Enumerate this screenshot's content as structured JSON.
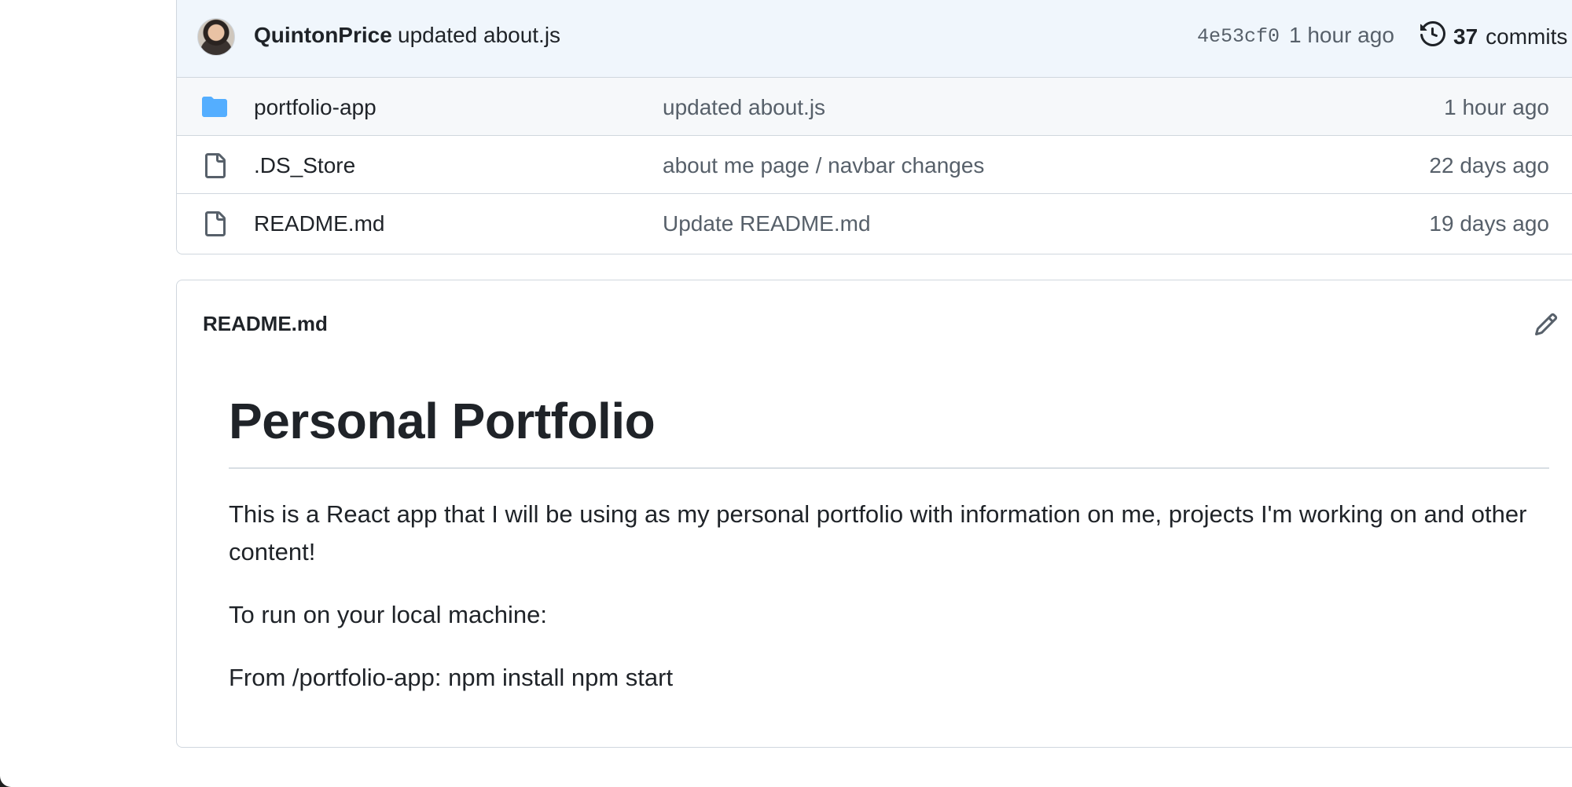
{
  "latest_commit": {
    "author": "QuintonPrice",
    "message": "updated about.js",
    "hash": "4e53cf0",
    "time": "1 hour ago",
    "commit_count": "37",
    "commits_label": "commits"
  },
  "files": [
    {
      "type": "folder",
      "icon": "folder-icon",
      "name": "portfolio-app",
      "last_commit": "updated about.js",
      "age": "1 hour ago"
    },
    {
      "type": "file",
      "icon": "file-icon",
      "name": ".DS_Store",
      "last_commit": "about me page / navbar changes",
      "age": "22 days ago"
    },
    {
      "type": "file",
      "icon": "file-icon",
      "name": "README.md",
      "last_commit": "Update README.md",
      "age": "19 days ago"
    }
  ],
  "readme": {
    "filename": "README.md",
    "heading": "Personal Portfolio",
    "paragraphs": [
      "This is a React app that I will be using as my personal portfolio with information on me, projects I'm working on and other content!",
      "To run on your local machine:",
      "From /portfolio-app: npm install npm start"
    ]
  },
  "colors": {
    "commit_bar_bg": "#f0f6fc",
    "folder_icon": "#54aeff",
    "file_icon": "#57606a",
    "border": "#d0d7de",
    "muted_text": "#57606a"
  }
}
